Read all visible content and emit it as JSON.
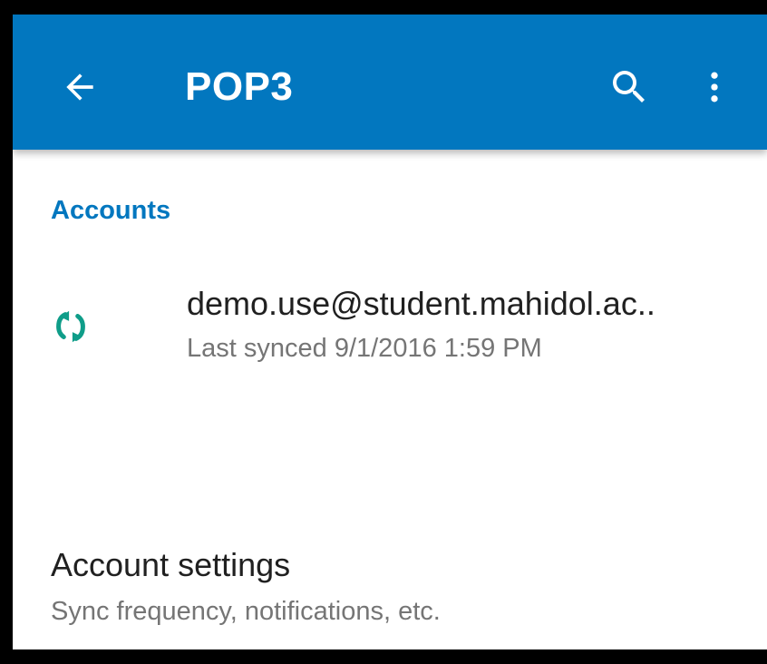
{
  "colors": {
    "appbar": "#0277bf",
    "accent": "#0277bf",
    "sync_icon": "#0f9d89",
    "primary_text": "#202020",
    "secondary_text": "#757575"
  },
  "appbar": {
    "title": "POP3",
    "back_icon": "arrow-left-icon",
    "search_icon": "search-icon",
    "more_icon": "more-vertical-icon"
  },
  "accounts": {
    "header": "Accounts",
    "items": [
      {
        "icon": "sync-icon",
        "email": "demo.use@student.mahidol.ac..",
        "status": "Last synced 9/1/2016 1:59 PM"
      }
    ]
  },
  "settings": {
    "title": "Account settings",
    "subtitle": "Sync frequency, notifications, etc."
  }
}
